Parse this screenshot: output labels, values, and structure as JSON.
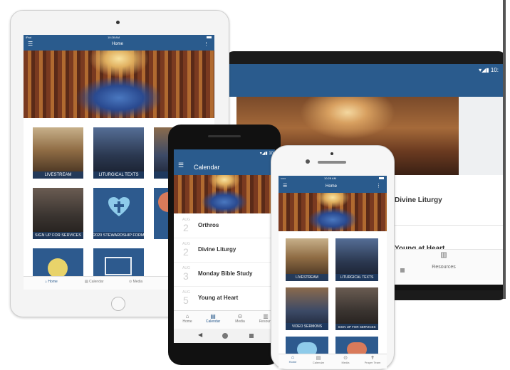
{
  "ipad": {
    "status_left": "iPad",
    "status_time": "10:28 AM",
    "title": "Home",
    "tiles": [
      {
        "label": "LIVESTREAM"
      },
      {
        "label": "LITURGICAL TEXTS"
      },
      {
        "label": "VID"
      },
      {
        "label": "SIGN UP FOR SERVICES"
      },
      {
        "label": "2020 STEWARDSHIP FORM"
      },
      {
        "label": ""
      },
      {
        "label": ""
      },
      {
        "label": ""
      }
    ],
    "tabs": [
      {
        "label": "Home"
      },
      {
        "label": "Calendar"
      },
      {
        "label": "Media"
      }
    ]
  },
  "tablet": {
    "status_time": "10:",
    "list": [
      {
        "title": "Divine Liturgy"
      },
      {
        "title": "Young at Heart"
      }
    ],
    "tab_resources": "Resources"
  },
  "android": {
    "status_time": "10",
    "title": "Calendar",
    "events": [
      {
        "month": "AUG",
        "day": "2",
        "title": "Orthros"
      },
      {
        "month": "AUG",
        "day": "2",
        "title": "Divine Liturgy"
      },
      {
        "month": "AUG",
        "day": "3",
        "title": "Monday Bible Study"
      },
      {
        "month": "AUG",
        "day": "5",
        "title": "Young at Heart"
      }
    ],
    "tabs": [
      {
        "label": "Home"
      },
      {
        "label": "Calendar"
      },
      {
        "label": "Media"
      },
      {
        "label": "Resourc"
      }
    ]
  },
  "iphone": {
    "status_left": "•••••",
    "status_time": "10:28 AM",
    "title": "Home",
    "tiles": [
      {
        "label": "LIVESTREAM"
      },
      {
        "label": "LITURGICAL TEXTS"
      },
      {
        "label": "VIDEO SERMONS"
      },
      {
        "label": "SIGN UP FOR SERVICES"
      },
      {
        "label": ""
      },
      {
        "label": ""
      }
    ],
    "tabs": [
      {
        "label": "Home"
      },
      {
        "label": "Calendar"
      },
      {
        "label": "Media"
      },
      {
        "label": "Prayer Team"
      }
    ]
  },
  "colors": {
    "brand": "#2a5b8d",
    "accent": "#2a5b8d"
  }
}
